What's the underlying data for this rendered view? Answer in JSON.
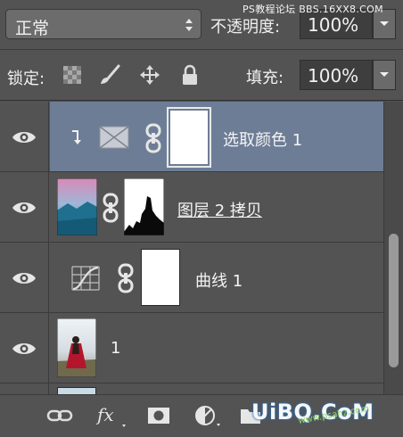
{
  "header": {
    "blend_mode": "正常",
    "opacity_label": "不透明度:",
    "opacity_value": "100%",
    "watermark": "PS教程论坛 BBS.16XX8.COM"
  },
  "lockbar": {
    "lock_label": "锁定:",
    "fill_label": "填充:",
    "fill_value": "100%"
  },
  "layers": [
    {
      "name": "选取颜色 1",
      "selected": true,
      "clipped": true,
      "type": "adjustment-selective-color"
    },
    {
      "name": "图层 2 拷贝",
      "selected": false,
      "type": "pixel-with-mask"
    },
    {
      "name": "曲线 1",
      "selected": false,
      "type": "adjustment-curves"
    },
    {
      "name": "1",
      "selected": false,
      "type": "pixel"
    }
  ],
  "footer": {
    "watermark": "UiBQ.CoM",
    "watermark_sub": "www.psahz.com"
  },
  "colors": {
    "panel_bg": "#535353",
    "selected_row": "#6d7d96",
    "field_bg": "#3e3e3e"
  }
}
